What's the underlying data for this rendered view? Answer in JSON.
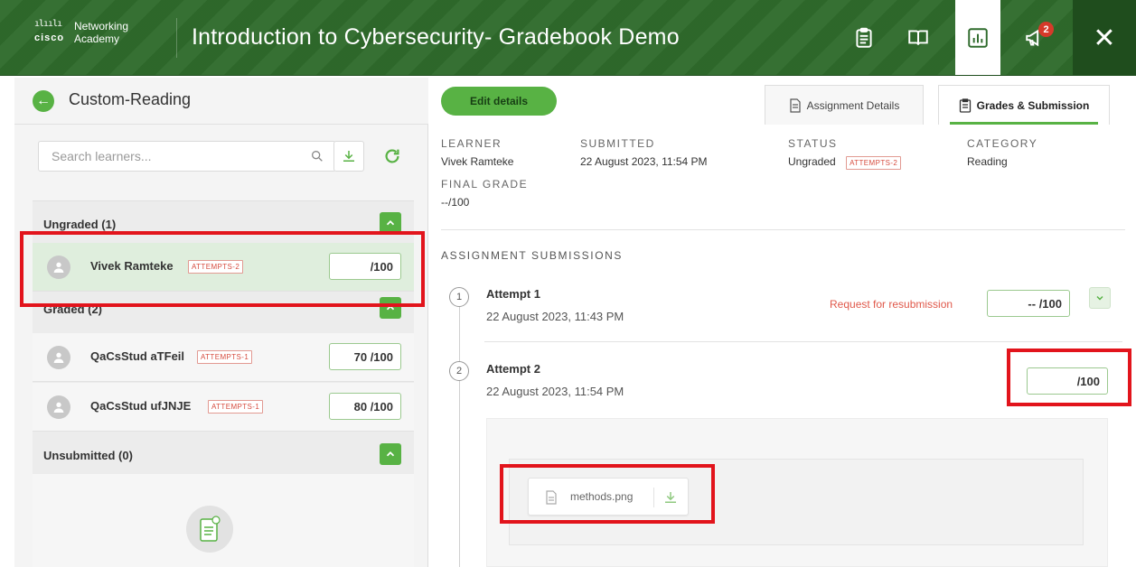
{
  "header": {
    "logo_brand": "cisco",
    "logo_line1": "Networking",
    "logo_line2": "Academy",
    "title": "Introduction to Cybersecurity- Gradebook Demo",
    "notification_count": "2",
    "close_label": "✕",
    "icons": [
      "clipboard-icon",
      "book-icon",
      "gradebook-chart-icon",
      "megaphone-icon"
    ]
  },
  "left": {
    "back_label": "←",
    "title": "Custom-Reading",
    "search_placeholder": "Search learners...",
    "groups": [
      {
        "label": "Ungraded (1)"
      },
      {
        "label": "Graded (2)"
      },
      {
        "label": "Unsubmitted (0)"
      }
    ],
    "learners": [
      {
        "name": "Vivek Ramteke",
        "tag": "ATTEMPTS-2",
        "grade": "/100"
      },
      {
        "name": "QaCsStud aTFeil",
        "tag": "ATTEMPTS-1",
        "grade": "70 /100"
      },
      {
        "name": "QaCsStud ufJNJE",
        "tag": "ATTEMPTS-1",
        "grade": "80 /100"
      }
    ]
  },
  "right": {
    "edit_label": "Edit details",
    "tabs": [
      {
        "label": "Assignment Details"
      },
      {
        "label": "Grades & Submission"
      }
    ],
    "info": {
      "learner_key": "LEARNER",
      "learner_val": "Vivek Ramteke",
      "final_grade_key": "FINAL GRADE",
      "final_grade_val": "--/100",
      "submitted_key": "SUBMITTED",
      "submitted_val": "22 August 2023, 11:54 PM",
      "status_key": "STATUS",
      "status_val": "Ungraded",
      "status_tag": "ATTEMPTS-2",
      "category_key": "CATEGORY",
      "category_val": "Reading"
    },
    "submissions_heading": "ASSIGNMENT SUBMISSIONS",
    "attempts": [
      {
        "num": "1",
        "title": "Attempt 1",
        "date": "22 August 2023, 11:43 PM",
        "grade": "-- /100"
      },
      {
        "num": "2",
        "title": "Attempt 2",
        "date": "22 August 2023, 11:54 PM",
        "grade": "/100"
      }
    ],
    "resubmit_label": "Request for resubmission",
    "file": {
      "name": "methods.png"
    }
  },
  "colors": {
    "header_green": "#2f6b2c",
    "accent_green": "#58b244",
    "annotation_red": "#e2141c",
    "tag_red": "#d64b3e"
  }
}
